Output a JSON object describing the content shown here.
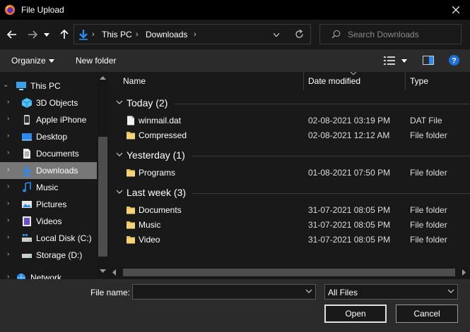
{
  "window": {
    "title": "File Upload"
  },
  "address": {
    "segments": [
      "This PC",
      "Downloads"
    ]
  },
  "search": {
    "placeholder": "Search Downloads"
  },
  "toolbar": {
    "organize_label": "Organize",
    "new_folder_label": "New folder"
  },
  "sidebar": {
    "items": [
      {
        "label": "This PC",
        "icon": "pc-icon",
        "expanded": true
      },
      {
        "label": "3D Objects",
        "icon": "3d-objects-icon"
      },
      {
        "label": "Apple iPhone",
        "icon": "phone-icon"
      },
      {
        "label": "Desktop",
        "icon": "desktop-icon"
      },
      {
        "label": "Documents",
        "icon": "documents-icon"
      },
      {
        "label": "Downloads",
        "icon": "downloads-icon",
        "selected": true
      },
      {
        "label": "Music",
        "icon": "music-icon"
      },
      {
        "label": "Pictures",
        "icon": "pictures-icon"
      },
      {
        "label": "Videos",
        "icon": "videos-icon"
      },
      {
        "label": "Local Disk (C:)",
        "icon": "local-disk-icon"
      },
      {
        "label": "Storage (D:)",
        "icon": "drive-icon"
      },
      {
        "label": "Network",
        "icon": "network-icon"
      }
    ]
  },
  "columns": {
    "name": "Name",
    "date": "Date modified",
    "type": "Type"
  },
  "groups": [
    {
      "label": "Today (2)",
      "files": [
        {
          "name": "winmail.dat",
          "date": "02-08-2021 03:19 PM",
          "type": "DAT File",
          "icon": "file-icon"
        },
        {
          "name": "Compressed",
          "date": "02-08-2021 12:12 AM",
          "type": "File folder",
          "icon": "folder-icon"
        }
      ]
    },
    {
      "label": "Yesterday (1)",
      "files": [
        {
          "name": "Programs",
          "date": "01-08-2021 07:50 PM",
          "type": "File folder",
          "icon": "folder-icon"
        }
      ]
    },
    {
      "label": "Last week (3)",
      "files": [
        {
          "name": "Documents",
          "date": "31-07-2021 08:05 PM",
          "type": "File folder",
          "icon": "folder-icon"
        },
        {
          "name": "Music",
          "date": "31-07-2021 08:05 PM",
          "type": "File folder",
          "icon": "folder-icon"
        },
        {
          "name": "Video",
          "date": "31-07-2021 08:05 PM",
          "type": "File folder",
          "icon": "folder-icon"
        }
      ]
    }
  ],
  "bottom": {
    "file_name_label": "File name:",
    "file_name_value": "",
    "filter_value": "All Files",
    "open_label": "Open",
    "cancel_label": "Cancel"
  },
  "colors": {
    "selection": "#777777",
    "folder": "#e8c25a",
    "accent_blue": "#2a8cf0",
    "help_blue": "#1a6fd8"
  }
}
